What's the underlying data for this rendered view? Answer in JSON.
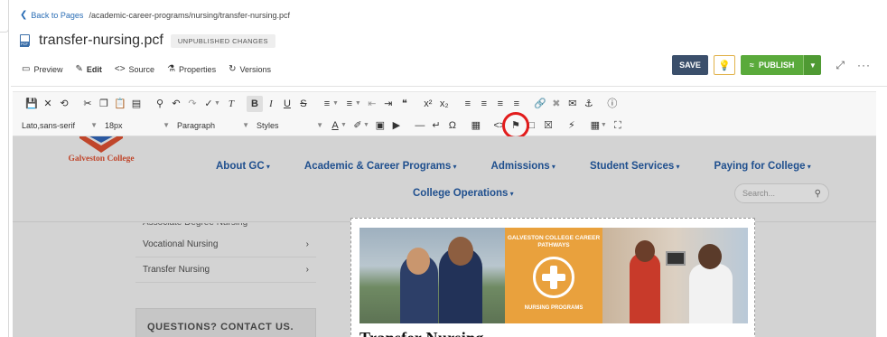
{
  "breadcrumb": {
    "back_label": "Back to Pages",
    "path": "/academic-career-programs/nursing/transfer-nursing.pcf"
  },
  "file": {
    "name": "transfer-nursing.pcf",
    "status_badge": "UNPUBLISHED CHANGES",
    "icon_tag": "PCF"
  },
  "tabs": [
    {
      "label": "Preview",
      "active": false
    },
    {
      "label": "Edit",
      "active": true
    },
    {
      "label": "Source",
      "active": false
    },
    {
      "label": "Properties",
      "active": false
    },
    {
      "label": "Versions",
      "active": false
    }
  ],
  "actions": {
    "save_label": "SAVE",
    "publish_label": "PUBLISH",
    "more_label": "···"
  },
  "toolbar": {
    "font_family": "Lato,sans-serif",
    "font_size": "18px",
    "block_format": "Paragraph",
    "styles": "Styles"
  },
  "site": {
    "logo_text": "Galveston College",
    "nav_primary": [
      "About GC",
      "Academic & Career Programs",
      "Admissions",
      "Student Services",
      "Paying for College"
    ],
    "nav_secondary": "College Operations",
    "search_placeholder": "Search...",
    "sidenav_cut": "Associate Degree Nursing",
    "sidenav_items": [
      "Vocational Nursing",
      "Transfer Nursing"
    ],
    "contact_heading": "QUESTIONS? CONTACT US.",
    "banner_top": "GALVESTON COLLEGE CAREER PATHWAYS",
    "banner_bottom": "NURSING PROGRAMS",
    "page_heading": "Transfer Nursing"
  },
  "colors": {
    "highlight_ring": "#e21c1c",
    "publish": "#5aaa3b",
    "save": "#3b4f6b",
    "nav": "#1f4f8e",
    "banner": "#e9a13d"
  }
}
